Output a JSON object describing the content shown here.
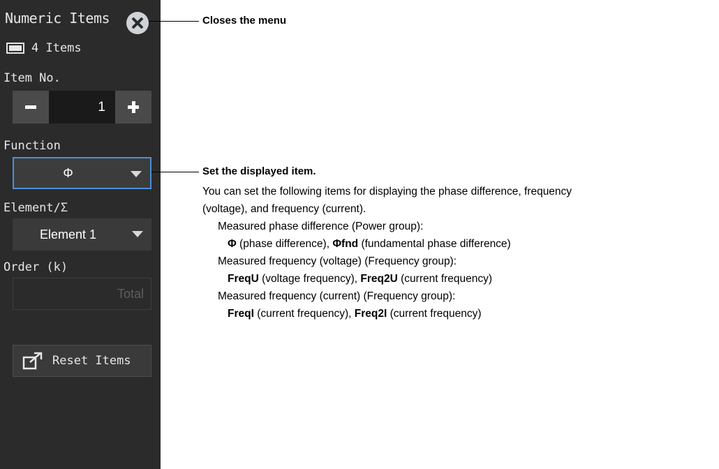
{
  "panel": {
    "title": "Numeric Items",
    "items_count": "4 Items",
    "item_no_label": "Item No.",
    "item_no_value": "1",
    "function_label": "Function",
    "function_value": "Φ",
    "element_label": "Element/Σ",
    "element_value": "Element 1",
    "order_label": "Order (k)",
    "order_value": "Total",
    "reset_label": "Reset Items"
  },
  "callouts": {
    "close": "Closes the menu",
    "function_title": "Set the displayed item.",
    "intro_1": "You can set the following items for displaying the phase difference, frequency",
    "intro_2": "(voltage), and frequency (current).",
    "power_heading": "Measured phase difference (Power group):",
    "power_a_bold": "Φ",
    "power_a_text": " (phase difference), ",
    "power_b_bold": "Φfnd",
    "power_b_text": " (fundamental phase difference)",
    "freqv_heading": "Measured frequency (voltage) (Frequency group):",
    "freqv_a_bold": "FreqU",
    "freqv_a_text": " (voltage frequency), ",
    "freqv_b_bold": "Freq2U",
    "freqv_b_text": " (current frequency)",
    "freqi_heading": "Measured frequency (current) (Frequency group):",
    "freqi_a_bold": "FreqI",
    "freqi_a_text": " (current frequency), ",
    "freqi_b_bold": "Freq2I",
    "freqi_b_text": " (current frequency)"
  },
  "colors": {
    "panel_bg": "#2b2b2b",
    "selected_border": "#4a90d9",
    "button_bg": "#4a4a4a"
  }
}
